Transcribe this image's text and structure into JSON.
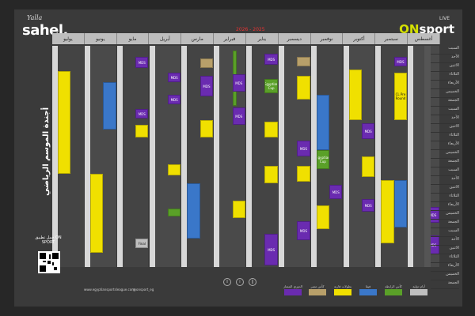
{
  "brand_left": {
    "small": "Yalla",
    "big": "sahel."
  },
  "brand_right": {
    "live": "LIVE",
    "name_a": "ON",
    "name_b": "sport"
  },
  "season": "2026 - 2025",
  "title_vertical": "أجندة الموسم الرياضي",
  "months": [
    "يوليو",
    "يونيو",
    "مايو",
    "أبريل",
    "مارس",
    "فبراير",
    "يناير",
    "ديسمبر",
    "نوفمبر",
    "أكتوبر",
    "سبتمبر",
    "أغسطس"
  ],
  "weekdays": [
    "السبت",
    "الأحد",
    "الاثنين",
    "الثلاثاء",
    "الأربعاء",
    "الخميس",
    "الجمعة",
    "السبت",
    "الأحد",
    "الاثنين",
    "الثلاثاء",
    "الأربعاء",
    "الخميس",
    "الجمعة",
    "السبت",
    "الأحد",
    "الاثنين",
    "الثلاثاء",
    "الأربعاء",
    "الخميس",
    "الجمعة",
    "السبت",
    "الأحد",
    "الاثنين",
    "الثلاثاء",
    "الأربعاء",
    "الخميس",
    "الجمعة"
  ],
  "blocks": {
    "afcon": "AFCON 2027",
    "international": "International",
    "mds": "MDS",
    "egy_cup": "Egyptian Cup",
    "cl_r16": "CL Pre Round",
    "cwc": "Club World Cup",
    "final": "Final"
  },
  "qr": {
    "title": "حمل تطبيق ON SPORT"
  },
  "footer": {
    "url": "www.egyptiansportsleague.com",
    "social": "@onsport_eg"
  },
  "legend": [
    {
      "label": "الدوري الممتاز",
      "color": "#6a2bb0"
    },
    {
      "label": "كأس مصر",
      "color": "#b8a06a"
    },
    {
      "label": "بطولات قارية",
      "color": "#f0e000"
    },
    {
      "label": "فيفا",
      "color": "#3a77c9"
    },
    {
      "label": "كأس الرابطة",
      "color": "#5aa028"
    },
    {
      "label": "أيام دولية",
      "color": "#bfbfbf"
    }
  ],
  "colors": {
    "bg": "#272727",
    "panel": "#3a3a3a",
    "yellow": "#f0e000",
    "purple": "#6a2bb0",
    "green": "#5aa028",
    "blue": "#3a77c9"
  }
}
